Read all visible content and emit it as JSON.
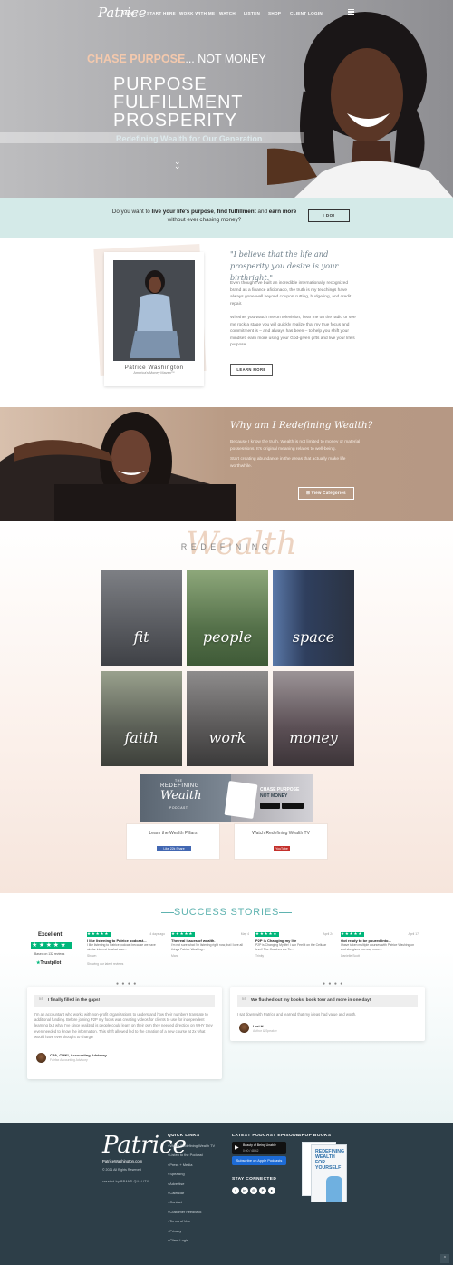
{
  "nav": {
    "logo": "Patrice",
    "links": [
      "ABOUT",
      "START HERE",
      "WORK WITH ME",
      "WATCH",
      "LISTEN",
      "SHOP",
      "CLIENT LOGIN"
    ]
  },
  "hero": {
    "chase_a": "CHASE PURPOSE",
    "chase_b": "... NOT MONEY",
    "words": [
      "PURPOSE",
      "FULFILLMENT",
      "PROSPERITY"
    ],
    "tagline": "Redefining Wealth for Our Generation"
  },
  "cta": {
    "t1": "Do you want to ",
    "b1": "live your life's purpose",
    "t2": ", ",
    "b2": "find fulfillment",
    "t3": " and ",
    "b3": "earn more",
    "t4": " without ever chasing money?",
    "button": "I DO!"
  },
  "about": {
    "name": "Patrice Washington",
    "title": "America's Money Maven™",
    "quote": "\"I believe that the life and prosperity you desire is your birthright.\"",
    "p1": "Even though I've built an incredible internationally recognized brand as a finance aficionado, the truth is my teachings have always gone well beyond coupon cutting, budgeting, and credit repair.",
    "p2": "Whether you watch me on television, hear me on the radio or see me rock a stage you will quickly realize that my true focus and commitment is – and always has been – to help you shift your mindset, earn more using your God-given gifts and live your life's purpose.",
    "button": "LEARN MORE"
  },
  "why": {
    "title": "Why am I Redefining Wealth?",
    "p1": "Because I know the truth. Wealth is not limited to money or material possessions. It's original meaning relates to well-being.",
    "p2": "Start creating abundance in the areas that actually make life worthwhile.",
    "button": "View Categories"
  },
  "redefining": {
    "heading": "REDEFINING",
    "script": "Wealth",
    "pillars": [
      "fit",
      "people",
      "space",
      "faith",
      "work",
      "money"
    ],
    "banner_title_small": "THE",
    "banner_title": "REDEFINING",
    "banner_script": "Wealth",
    "banner_podcast": "PODCAST",
    "banner_chase": "CHASE PURPOSE",
    "banner_not": "NOT MONEY",
    "box1_label": "Learn the Wealth Pillars",
    "box1_button": "Like 22k  Share",
    "box2_label": "Watch Redefining Wealth TV",
    "box2_button": "YouTube"
  },
  "success": {
    "title": "SUCCESS STORIES",
    "trustpilot": {
      "excellent": "Excellent",
      "based": "Based on 132 reviews",
      "brand": "Trustpilot"
    },
    "reviews": [
      {
        "title": "I like listening to Patrice podcast...",
        "date": "4 days ago",
        "body": "I like listening to Patrice podcast because we have similar interest to what was...",
        "name": "Shown",
        "footer": "Showing our latest reviews"
      },
      {
        "title": "The real issues of wealth.",
        "date": "May 4",
        "body": "I'm not sure what I'm listening right now, but I love all things Patrice Washing...",
        "name": "Mara"
      },
      {
        "title": "P2P is Changing my life",
        "date": "April 24",
        "body": "P2P is Changing My life! I can Feel it on the Cellular level! The Coaches are To...",
        "name": "Trinity"
      },
      {
        "title": "Got ready to be poured into...",
        "date": "April 17",
        "body": "I have taken multiple courses with Patrice Washington and she gives you way more...",
        "name": "Danielle Scott"
      }
    ],
    "testimonials": [
      {
        "title": "I finally filled in the gaps!",
        "body": "I'm an accountant who works with non-profit organizations to understand how their numbers translate to additional funding. Before joining P2P my focus was creating videos for clients to use for independent learning but what I've since realized is people could learn on their own they needed direction on WHY they even needed to know the information. This shift allowed led to the creation of a new course at 2x what I would have ever thought to charge!",
        "name": "CPA, CMKI, Accounting Advisory",
        "sub": "Fairfax Accounting Advisory"
      },
      {
        "title": "We flushed out my books, book tour and more in one day!",
        "body": "I sat down with Patrice and learned that my ideas had value and worth.",
        "name": "Lori H.",
        "sub": "Author & Speaker"
      }
    ]
  },
  "footer": {
    "site": "PatriceWashington.com",
    "copyright": "© 2021 All Rights Reserved",
    "credit": "created by BRAND QUALITY",
    "quick_links_title": "QUICK LINKS",
    "quick_links": [
      "Watch Redefining Wealth TV",
      "Listen to the Podcast",
      "Press + Media",
      "Speaking",
      "Advertise",
      "Calendar",
      "Contact",
      "Customer Feedback",
      "Terms of Use",
      "Privacy",
      "Client Login"
    ],
    "podcast_title": "LATEST PODCAST EPISODE",
    "podcast_episode": "Beauty of Being Unable",
    "podcast_time": "0:00 / 48:42",
    "podcast_button": "Subscribe on Apple Podcasts",
    "stay_connected": "STAY CONNECTED",
    "shop_title": "SHOP BOOKS",
    "book_title": "REDEFINING WEALTH FOR YOURSELF"
  }
}
